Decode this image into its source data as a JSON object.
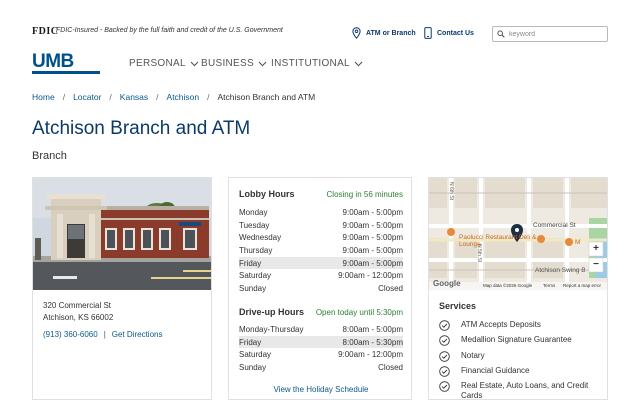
{
  "topbar": {
    "fdic_logo": "FDIC",
    "fdic_text": "FDIC-Insured - Backed by the full faith and credit of the U.S. Government",
    "atm_link": "ATM or Branch",
    "contact_link": "Contact Us",
    "search_placeholder": "keyword"
  },
  "nav": {
    "logo": "UMB",
    "items": [
      {
        "label": "PERSONAL"
      },
      {
        "label": "BUSINESS"
      },
      {
        "label": "INSTITUTIONAL"
      }
    ]
  },
  "breadcrumb": {
    "items": [
      "Home",
      "Locator",
      "Kansas",
      "Atchison"
    ],
    "separator": "/",
    "current": "Atchison Branch and ATM"
  },
  "page": {
    "title": "Atchison Branch and ATM",
    "subtitle": "Branch"
  },
  "branch": {
    "address_line1": "320 Commercial St",
    "address_line2": "Atchison, KS 66002",
    "phone": "(913) 360-6060",
    "separator": "|",
    "directions": "Get Directions"
  },
  "lobby": {
    "heading": "Lobby Hours",
    "status": "Closing in 56 minutes",
    "rows": [
      {
        "day": "Monday",
        "hours": "9:00am - 5:00pm",
        "highlight": false
      },
      {
        "day": "Tuesday",
        "hours": "9:00am - 5:00pm",
        "highlight": false
      },
      {
        "day": "Wednesday",
        "hours": "9:00am - 5:00pm",
        "highlight": false
      },
      {
        "day": "Thursday",
        "hours": "9:00am - 5:00pm",
        "highlight": false
      },
      {
        "day": "Friday",
        "hours": "9:00am - 5:00pm",
        "highlight": true
      },
      {
        "day": "Saturday",
        "hours": "9:00am - 12:00pm",
        "highlight": false
      },
      {
        "day": "Sunday",
        "hours": "Closed",
        "highlight": false
      }
    ]
  },
  "driveup": {
    "heading": "Drive-up Hours",
    "status": "Open today until 5:30pm",
    "rows": [
      {
        "day": "Monday-Thursday",
        "hours": "8:00am - 5:00pm",
        "highlight": false
      },
      {
        "day": "Friday",
        "hours": "8:00am - 5:30pm",
        "highlight": true
      },
      {
        "day": "Saturday",
        "hours": "9:00am - 12:00pm",
        "highlight": false
      },
      {
        "day": "Sunday",
        "hours": "Closed",
        "highlight": false
      }
    ]
  },
  "holiday_link": "View the Holiday Schedule",
  "map": {
    "street_labels": [
      "Commercial St",
      "N 6th St",
      "N 5th St"
    ],
    "poi_labels": [
      "Paolucci Restaurant Deli & Lounge",
      "Atchison Swing B",
      "M"
    ],
    "attribution_logo": "Google",
    "attribution": "Map data ©2026 Google",
    "terms": "Terms",
    "report": "Report a map error",
    "zoom_in": "+",
    "zoom_out": "−"
  },
  "services": {
    "title": "Services",
    "items": [
      "ATM Accepts Deposits",
      "Medallion Signature Guarantee",
      "Notary",
      "Financial Guidance",
      "Real Estate, Auto Loans, and Credit Cards"
    ]
  },
  "colors": {
    "brand_blue": "#00508a",
    "link_blue": "#0b5a8c",
    "title_blue": "#0b3a6a",
    "status_green": "#2e7d32",
    "highlight_gray": "#e8e8e8"
  }
}
